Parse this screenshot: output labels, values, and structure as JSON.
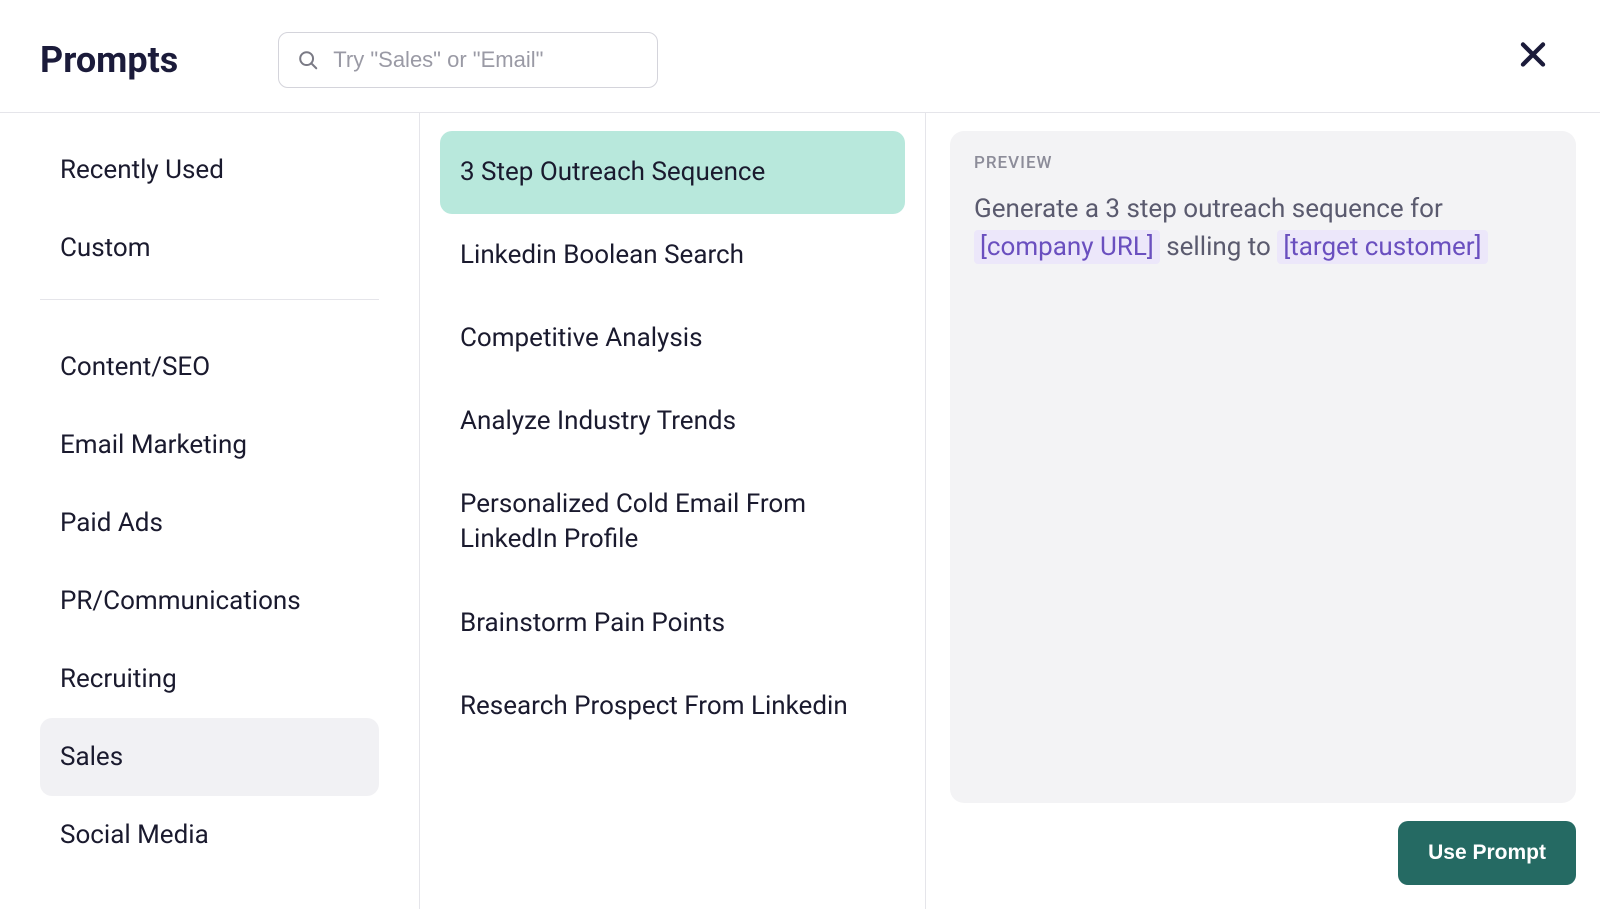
{
  "header": {
    "title": "Prompts",
    "search_placeholder": "Try \"Sales\" or \"Email\""
  },
  "sidebar": {
    "top": [
      {
        "label": "Recently Used"
      },
      {
        "label": "Custom"
      }
    ],
    "categories": [
      {
        "label": "Content/SEO"
      },
      {
        "label": "Email Marketing"
      },
      {
        "label": "Paid Ads"
      },
      {
        "label": "PR/Communications"
      },
      {
        "label": "Recruiting"
      },
      {
        "label": "Sales",
        "active": true
      },
      {
        "label": "Social Media"
      }
    ]
  },
  "prompts": [
    {
      "label": "3 Step Outreach Sequence",
      "active": true
    },
    {
      "label": "Linkedin Boolean Search"
    },
    {
      "label": "Competitive Analysis"
    },
    {
      "label": "Analyze Industry Trends"
    },
    {
      "label": "Personalized Cold Email From LinkedIn Profile"
    },
    {
      "label": "Brainstorm Pain Points"
    },
    {
      "label": "Research Prospect From Linkedin"
    }
  ],
  "preview": {
    "label": "PREVIEW",
    "leading": "Generate a 3 step outreach sequence for ",
    "token1": "[company URL]",
    "middle": " selling to ",
    "token2": "[target customer]"
  },
  "actions": {
    "use_prompt": "Use Prompt"
  }
}
